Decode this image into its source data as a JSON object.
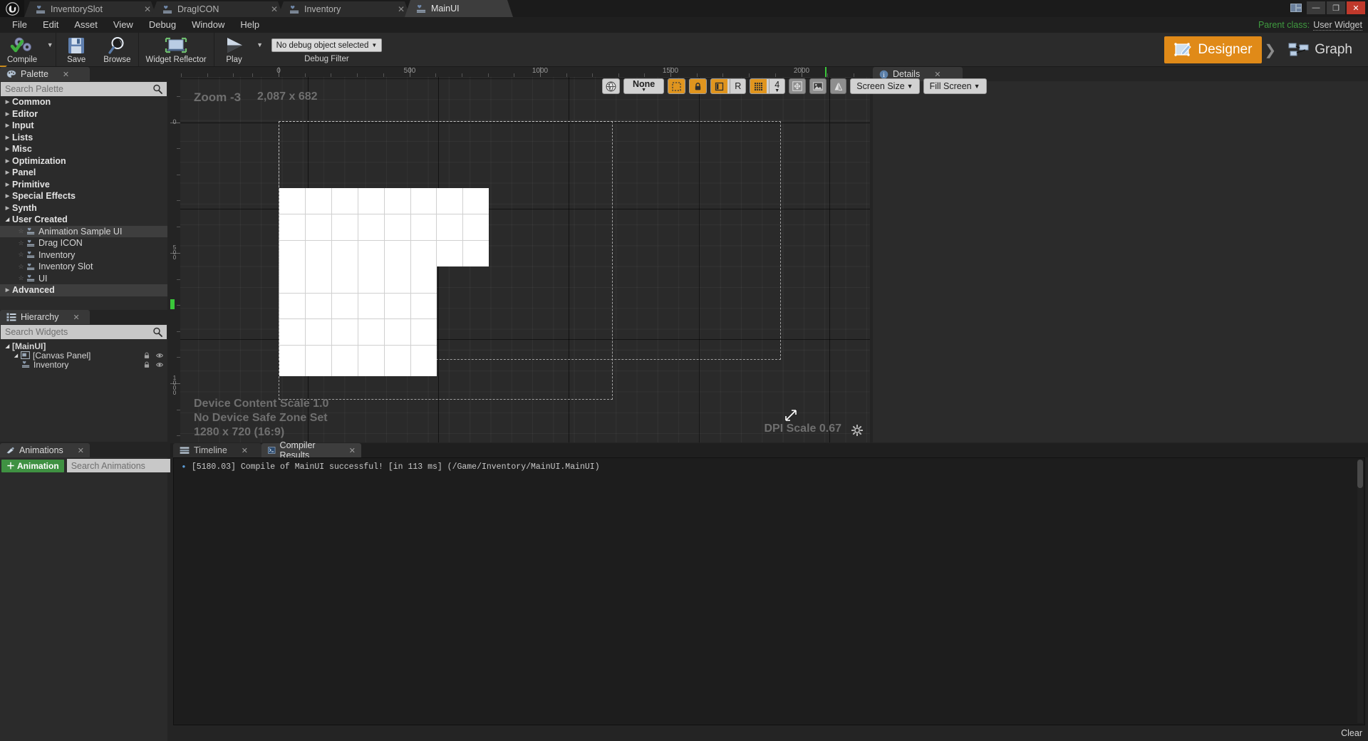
{
  "window": {
    "app_icon": "unreal-logo-icon",
    "tabs": [
      {
        "label": "InventorySlot",
        "icon": "widget-blueprint-icon",
        "active": false
      },
      {
        "label": "DragICON",
        "icon": "widget-blueprint-icon",
        "active": false
      },
      {
        "label": "Inventory",
        "icon": "widget-blueprint-icon",
        "active": false
      },
      {
        "label": "MainUI",
        "icon": "widget-blueprint-icon",
        "active": true
      }
    ],
    "controls": {
      "minimize": "minimize-icon",
      "maximize": "maximize-icon",
      "close": "close-icon"
    }
  },
  "menu": {
    "items": [
      "File",
      "Edit",
      "Asset",
      "View",
      "Debug",
      "Window",
      "Help"
    ],
    "parent_class_label": "Parent class:",
    "parent_class_value": "User Widget"
  },
  "toolbar": {
    "compile": {
      "label": "Compile",
      "icon": "compile-gears-check-icon"
    },
    "save": {
      "label": "Save",
      "icon": "save-floppy-icon"
    },
    "browse": {
      "label": "Browse",
      "icon": "browse-magnifier-icon"
    },
    "widget_reflector": {
      "label": "Widget Reflector",
      "icon": "widget-reflector-icon"
    },
    "play": {
      "label": "Play",
      "icon": "play-triangle-icon"
    },
    "debug_filter": {
      "value": "No debug object selected",
      "label": "Debug Filter"
    }
  },
  "mode_toggle": {
    "designer": {
      "label": "Designer",
      "icon": "designer-icon",
      "active": true
    },
    "graph": {
      "label": "Graph",
      "icon": "graph-icon",
      "active": false
    }
  },
  "palette": {
    "tab_title": "Palette",
    "tab_icon": "palette-icon",
    "search_placeholder": "Search Palette",
    "search_value": "",
    "categories": [
      {
        "label": "Common",
        "expanded": false
      },
      {
        "label": "Editor",
        "expanded": false
      },
      {
        "label": "Input",
        "expanded": false
      },
      {
        "label": "Lists",
        "expanded": false
      },
      {
        "label": "Misc",
        "expanded": false
      },
      {
        "label": "Optimization",
        "expanded": false
      },
      {
        "label": "Panel",
        "expanded": false
      },
      {
        "label": "Primitive",
        "expanded": false
      },
      {
        "label": "Special Effects",
        "expanded": false
      },
      {
        "label": "Synth",
        "expanded": false
      },
      {
        "label": "User Created",
        "expanded": true
      },
      {
        "label": "Advanced",
        "expanded": false,
        "highlighted": true
      }
    ],
    "user_created_items": [
      {
        "label": "Animation Sample UI"
      },
      {
        "label": "Drag ICON"
      },
      {
        "label": "Inventory"
      },
      {
        "label": "Inventory Slot"
      },
      {
        "label": "UI"
      }
    ]
  },
  "hierarchy": {
    "tab_title": "Hierarchy",
    "tab_icon": "hierarchy-icon",
    "search_placeholder": "Search Widgets",
    "search_value": "",
    "nodes": [
      {
        "label": "[MainUI]",
        "depth": 0,
        "expanded": true,
        "icons": false
      },
      {
        "label": "[Canvas Panel]",
        "depth": 1,
        "expanded": true,
        "icons": true
      },
      {
        "label": "Inventory",
        "depth": 2,
        "expanded": false,
        "icons": true
      }
    ]
  },
  "animations": {
    "tab_title": "Animations",
    "tab_icon": "animations-icon",
    "add_button": "Animation",
    "search_placeholder": "Search Animations",
    "search_value": ""
  },
  "details": {
    "tab_title": "Details",
    "tab_icon": "details-icon"
  },
  "viewport": {
    "zoom_label": "Zoom -3",
    "dimensions": "2,087 x 682",
    "device_content_scale": "Device Content Scale 1.0",
    "safe_zone": "No Device Safe Zone Set",
    "resolution": "1280 x 720 (16:9)",
    "dpi_scale": "DPI Scale 0.67",
    "settings_icon": "gear-icon",
    "ruler_h_labels": [
      "0",
      "500",
      "1000",
      "1500",
      "2000"
    ],
    "ruler_v_labels": [
      "0",
      "500",
      "1000"
    ],
    "toolbar": {
      "locale": {
        "icon": "globe-icon"
      },
      "none_combo": {
        "label": "None"
      },
      "dashed_outline": {
        "icon": "dashed-rect-icon",
        "active": true
      },
      "lock": {
        "icon": "lock-icon",
        "active": true
      },
      "anim_toggle": {
        "icon": "panel-icon",
        "active": true
      },
      "r_toggle": {
        "label": "R",
        "active": false
      },
      "grid_snap": {
        "icon": "grid-icon",
        "active": true
      },
      "grid_size": {
        "label": "4"
      },
      "size_to_content": {
        "icon": "size-to-content-icon"
      },
      "image_preview": {
        "icon": "image-icon"
      },
      "mirror": {
        "icon": "mirror-icon"
      },
      "screen_size": {
        "label": "Screen Size"
      },
      "fill_screen": {
        "label": "Fill Screen"
      }
    }
  },
  "bottom_panel": {
    "tabs": [
      {
        "label": "Timeline",
        "icon": "timeline-icon",
        "active": false
      },
      {
        "label": "Compiler Results",
        "icon": "compiler-results-icon",
        "active": true
      }
    ],
    "log_entries": [
      "[5180.03] Compile of MainUI successful! [in 113 ms] (/Game/Inventory/MainUI.MainUI)"
    ],
    "clear_button": "Clear"
  },
  "colors": {
    "accent_orange": "#e08a18",
    "green": "#3f9142",
    "panel_bg": "#2b2b2b",
    "window_bg": "#242424",
    "viewport_bg": "#2a2a2a"
  }
}
